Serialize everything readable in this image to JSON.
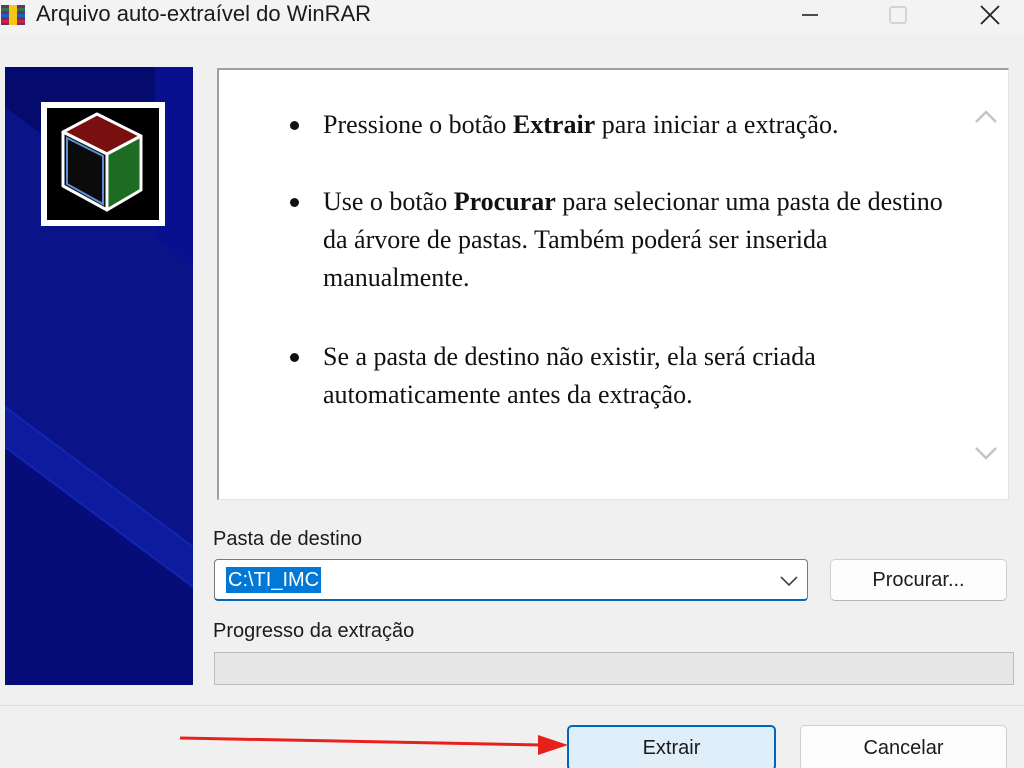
{
  "window": {
    "title": "Arquivo auto-extraível do WinRAR"
  },
  "info": {
    "bullets": [
      {
        "pre": "Pressione o botão ",
        "bold": "Extrair",
        "post": " para iniciar a extração."
      },
      {
        "pre": "Use o botão ",
        "bold": "Procurar",
        "post": " para selecionar uma pasta de destino da árvore de pastas. Também poderá ser inserida manualmente."
      },
      {
        "pre": "Se a pasta de destino não existir, ela será criada automaticamente antes da extração.",
        "bold": "",
        "post": ""
      }
    ]
  },
  "destination": {
    "label": "Pasta de destino",
    "value": "C:\\TI_IMC",
    "browse_label": "Procurar..."
  },
  "progress": {
    "label": "Progresso da extração",
    "value": 0
  },
  "actions": {
    "extract_label": "Extrair",
    "cancel_label": "Cancelar"
  },
  "colors": {
    "banner_dark": "#050a6e",
    "banner_mid": "#0a1488",
    "accent_blue": "#0067c0",
    "selection": "#0078d7",
    "annotation_red": "#e8201c"
  },
  "icons": {
    "app": "winrar-icon",
    "minimize": "minimize-icon",
    "maximize": "maximize-icon",
    "close": "close-icon",
    "logo": "winrar-box-logo-icon",
    "scroll_up": "chevron-up-icon",
    "scroll_down": "chevron-down-icon",
    "dropdown": "chevron-down-icon",
    "arrow": "red-arrow-annotation-icon"
  }
}
